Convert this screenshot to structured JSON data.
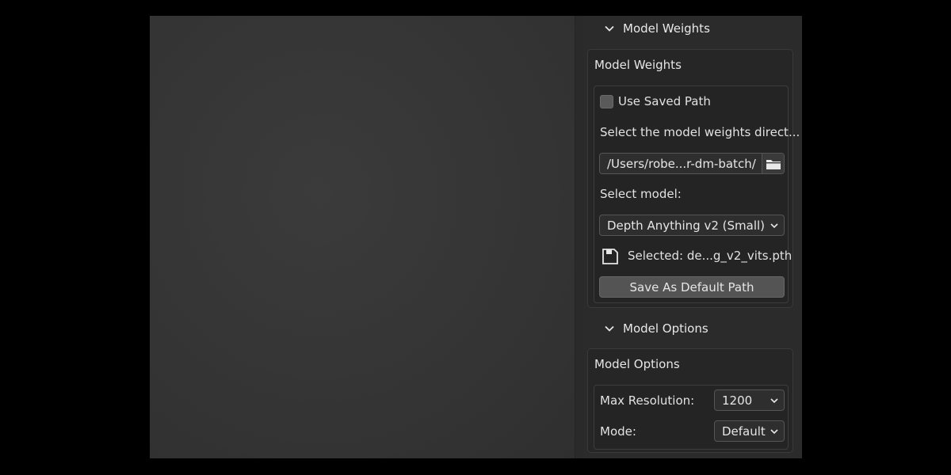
{
  "model_weights_section": {
    "header": "Model Weights",
    "box_title": "Model Weights",
    "use_saved_path_label": "Use Saved Path",
    "use_saved_path_checked": false,
    "select_dir_label": "Select the model weights direct...",
    "path_value": "/Users/robe...r-dm-batch/",
    "select_model_label": "Select model:",
    "model_value": "Depth Anything v2 (Small)",
    "selected_file": "Selected: de...g_v2_vits.pth",
    "save_default_button": "Save As Default Path",
    "icons": [
      "chevron-down-icon",
      "folder-icon",
      "file-icon"
    ]
  },
  "model_options_section": {
    "header": "Model Options",
    "box_title": "Model Options",
    "max_resolution_label": "Max Resolution:",
    "max_resolution_value": "1200",
    "mode_label": "Mode:",
    "mode_value": "Default"
  },
  "colors": {
    "background": "#000000",
    "viewport": "#353535",
    "panel": "#2b2b2b",
    "button": "#545454",
    "field": "#2e2e2e"
  }
}
